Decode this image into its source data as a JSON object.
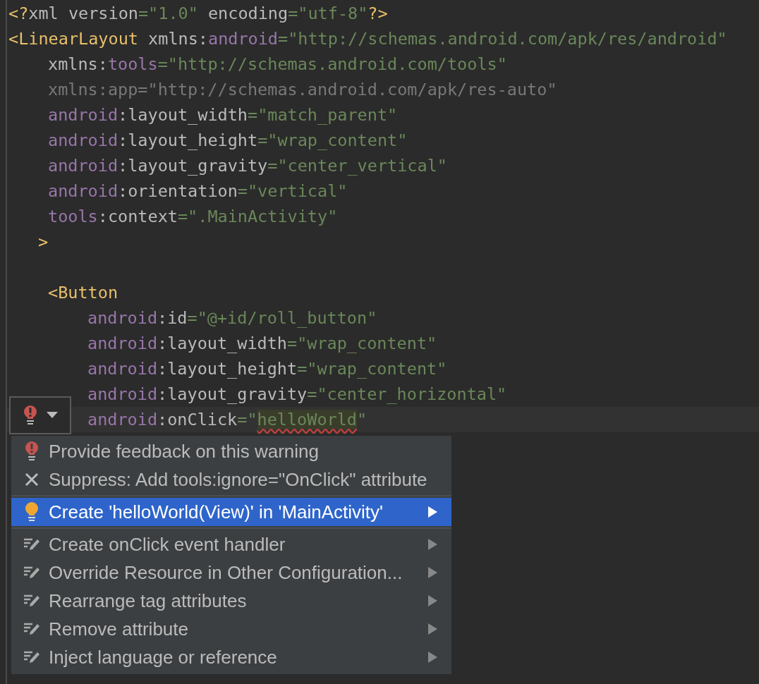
{
  "editor": {
    "lines": [
      {
        "current": false,
        "tokens": [
          {
            "kind": "tag",
            "text": "<?"
          },
          {
            "kind": "text",
            "text": "xml version"
          },
          {
            "kind": "str",
            "text": "=\"1.0\""
          },
          {
            "kind": "text",
            "text": " encoding"
          },
          {
            "kind": "str",
            "text": "=\"utf-8\""
          },
          {
            "kind": "tag",
            "text": "?>"
          }
        ]
      },
      {
        "current": false,
        "tokens": [
          {
            "kind": "tag",
            "text": "<LinearLayout"
          },
          {
            "kind": "text",
            "text": " xmlns:"
          },
          {
            "kind": "ns",
            "text": "android"
          },
          {
            "kind": "str",
            "text": "=\"http://schemas.android.com/apk/res/android\""
          }
        ],
        "children": [
          {
            "current": false,
            "tokens": [
              {
                "kind": "text",
                "text": "xmlns:"
              },
              {
                "kind": "ns",
                "text": "tools"
              },
              {
                "kind": "str",
                "text": "=\"http://schemas.android.com/tools\""
              }
            ]
          },
          {
            "current": false,
            "tokens": [
              {
                "kind": "dim",
                "text": "xmlns:app=\"http://schemas.android.com/apk/res-auto\""
              }
            ]
          },
          {
            "current": false,
            "tokens": [
              {
                "kind": "ns",
                "text": "android"
              },
              {
                "kind": "text",
                "text": ":layout_width"
              },
              {
                "kind": "str",
                "text": "=\"match_parent\""
              }
            ]
          },
          {
            "current": false,
            "tokens": [
              {
                "kind": "ns",
                "text": "android"
              },
              {
                "kind": "text",
                "text": ":layout_height"
              },
              {
                "kind": "str",
                "text": "=\"wrap_content\""
              }
            ]
          },
          {
            "current": false,
            "tokens": [
              {
                "kind": "ns",
                "text": "android"
              },
              {
                "kind": "text",
                "text": ":layout_gravity"
              },
              {
                "kind": "str",
                "text": "=\"center_vertical\""
              }
            ]
          },
          {
            "current": false,
            "tokens": [
              {
                "kind": "ns",
                "text": "android"
              },
              {
                "kind": "text",
                "text": ":orientation"
              },
              {
                "kind": "str",
                "text": "=\"vertical\""
              }
            ]
          },
          {
            "current": false,
            "tokens": [
              {
                "kind": "ns",
                "text": "tools"
              },
              {
                "kind": "text",
                "text": ":context"
              },
              {
                "kind": "str",
                "text": "=\".MainActivity\""
              }
            ]
          },
          {
            "current": false,
            "tokens": [
              {
                "kind": "close",
                "text": ">"
              }
            ]
          },
          {
            "current": false,
            "blank_line_before": true,
            "tokens": [
              {
                "kind": "tag",
                "text": "<Button"
              }
            ],
            "children": [
              {
                "current": false,
                "tokens": [
                  {
                    "kind": "ns",
                    "text": "android"
                  },
                  {
                    "kind": "text",
                    "text": ":id"
                  },
                  {
                    "kind": "str",
                    "text": "=\"@+id/roll_button\""
                  }
                ]
              },
              {
                "current": false,
                "tokens": [
                  {
                    "kind": "ns",
                    "text": "android"
                  },
                  {
                    "kind": "text",
                    "text": ":layout_width"
                  },
                  {
                    "kind": "str",
                    "text": "=\"wrap_content\""
                  }
                ]
              },
              {
                "current": false,
                "tokens": [
                  {
                    "kind": "ns",
                    "text": "android"
                  },
                  {
                    "kind": "text",
                    "text": ":layout_height"
                  },
                  {
                    "kind": "str",
                    "text": "=\"wrap_content\""
                  }
                ]
              },
              {
                "current": false,
                "tokens": [
                  {
                    "kind": "ns",
                    "text": "android"
                  },
                  {
                    "kind": "text",
                    "text": ":layout_gravity"
                  },
                  {
                    "kind": "str",
                    "text": "=\"center_horizontal\""
                  }
                ]
              },
              {
                "current": true,
                "tokens": [
                  {
                    "kind": "ns",
                    "text": "android"
                  },
                  {
                    "kind": "text",
                    "text": ":onClick"
                  },
                  {
                    "kind": "str",
                    "text": "=\""
                  },
                  {
                    "kind": "error",
                    "text": "helloWorld"
                  },
                  {
                    "kind": "str",
                    "text": "\""
                  }
                ]
              }
            ]
          }
        ]
      }
    ]
  },
  "intention_menu": {
    "groups": [
      [
        {
          "kind": "warning",
          "label": "Provide feedback on this warning",
          "has_submenu": false,
          "selected": false
        },
        {
          "kind": "suppress",
          "label": "Suppress: Add tools:ignore=\"OnClick\" attribute",
          "has_submenu": false,
          "selected": false
        }
      ],
      [
        {
          "kind": "quickfix",
          "label": "Create 'helloWorld(View)' in 'MainActivity'",
          "has_submenu": true,
          "selected": true
        }
      ],
      [
        {
          "kind": "intention",
          "label": "Create onClick event handler",
          "has_submenu": true,
          "selected": false
        },
        {
          "kind": "intention",
          "label": "Override Resource in Other Configuration...",
          "has_submenu": true,
          "selected": false
        },
        {
          "kind": "intention",
          "label": "Rearrange tag attributes",
          "has_submenu": true,
          "selected": false
        },
        {
          "kind": "intention",
          "label": "Remove attribute",
          "has_submenu": true,
          "selected": false
        },
        {
          "kind": "intention",
          "label": "Inject language or reference",
          "has_submenu": true,
          "selected": false
        }
      ]
    ]
  }
}
